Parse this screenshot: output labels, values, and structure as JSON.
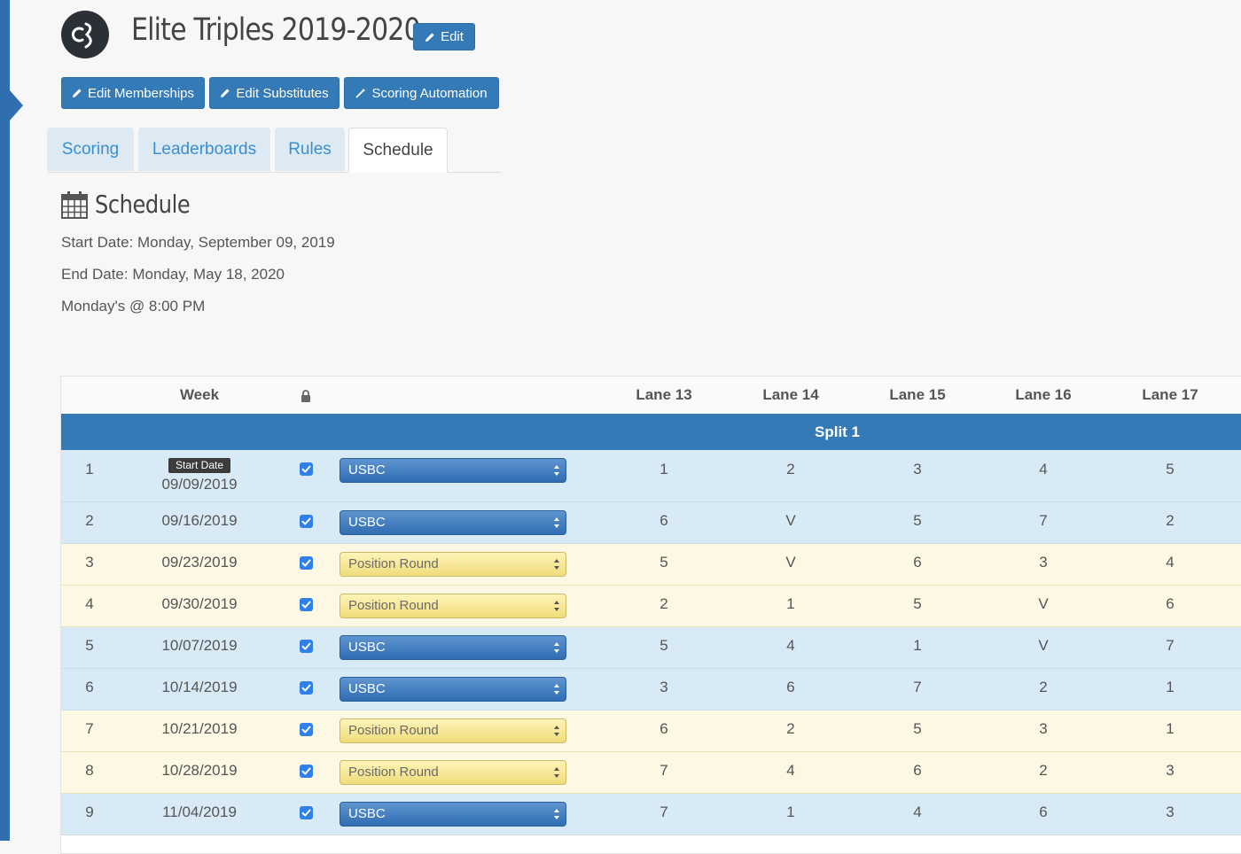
{
  "header": {
    "title": "Elite Triples 2019-2020",
    "edit_label": "Edit",
    "actions": [
      {
        "label": "Edit Memberships"
      },
      {
        "label": "Edit Substitutes"
      },
      {
        "label": "Scoring Automation"
      }
    ]
  },
  "tabs": [
    {
      "label": "Scoring",
      "active": false
    },
    {
      "label": "Leaderboards",
      "active": false
    },
    {
      "label": "Rules",
      "active": false
    },
    {
      "label": "Schedule",
      "active": true
    }
  ],
  "schedule": {
    "title": "Schedule",
    "start_date": "Start Date: Monday, September 09, 2019",
    "end_date": "End Date: Monday, May 18, 2020",
    "time": "Monday's @ 8:00 PM"
  },
  "table": {
    "headers": {
      "week": "Week",
      "lanes": [
        "Lane 13",
        "Lane 14",
        "Lane 15",
        "Lane 16",
        "Lane 17"
      ]
    },
    "split_label": "Split 1",
    "start_badge": "Start Date",
    "rows": [
      {
        "week": "1",
        "date": "09/09/2019",
        "locked": true,
        "format": "USBC",
        "lanes": [
          "1",
          "2",
          "3",
          "4",
          "5"
        ]
      },
      {
        "week": "2",
        "date": "09/16/2019",
        "locked": true,
        "format": "USBC",
        "lanes": [
          "6",
          "V",
          "5",
          "7",
          "2"
        ]
      },
      {
        "week": "3",
        "date": "09/23/2019",
        "locked": true,
        "format": "Position Round",
        "lanes": [
          "5",
          "V",
          "6",
          "3",
          "4"
        ]
      },
      {
        "week": "4",
        "date": "09/30/2019",
        "locked": true,
        "format": "Position Round",
        "lanes": [
          "2",
          "1",
          "5",
          "V",
          "6"
        ]
      },
      {
        "week": "5",
        "date": "10/07/2019",
        "locked": true,
        "format": "USBC",
        "lanes": [
          "5",
          "4",
          "1",
          "V",
          "7"
        ]
      },
      {
        "week": "6",
        "date": "10/14/2019",
        "locked": true,
        "format": "USBC",
        "lanes": [
          "3",
          "6",
          "7",
          "2",
          "1"
        ]
      },
      {
        "week": "7",
        "date": "10/21/2019",
        "locked": true,
        "format": "Position Round",
        "lanes": [
          "6",
          "2",
          "5",
          "3",
          "1"
        ]
      },
      {
        "week": "8",
        "date": "10/28/2019",
        "locked": true,
        "format": "Position Round",
        "lanes": [
          "7",
          "4",
          "6",
          "2",
          "3"
        ]
      },
      {
        "week": "9",
        "date": "11/04/2019",
        "locked": true,
        "format": "USBC",
        "lanes": [
          "7",
          "1",
          "4",
          "6",
          "3"
        ]
      }
    ]
  },
  "colors": {
    "primary": "#337ab7",
    "usbc_row": "#d9eaf7",
    "position_row": "#fcf8e3"
  },
  "icons": [
    "pencil-icon",
    "magic-wand-icon",
    "calendar-icon",
    "lock-icon",
    "checkbox-checked-icon",
    "select-arrows-icon"
  ]
}
